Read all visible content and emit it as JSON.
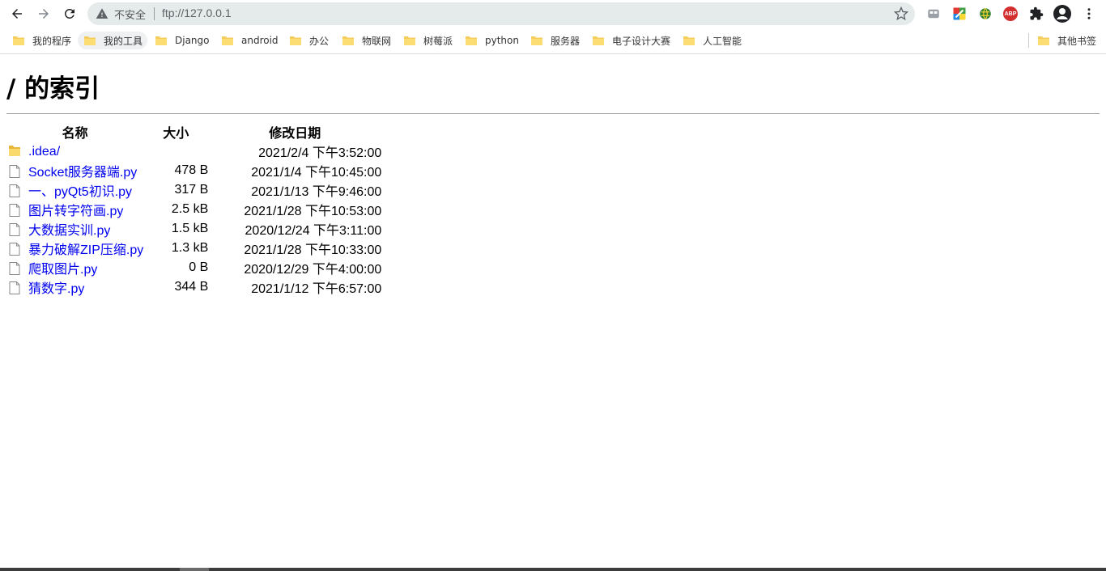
{
  "browser": {
    "security_label": "不安全",
    "url": "ftp://127.0.0.1",
    "icons": [
      "back-icon",
      "forward-icon",
      "reload-icon",
      "warning-icon",
      "star-icon",
      "tab-icon",
      "color-picker-icon",
      "globe-icon",
      "adblock-icon",
      "puzzle-icon",
      "profile-icon",
      "menu-icon"
    ],
    "adblock_label": "ABP"
  },
  "bookmarks": [
    {
      "label": "我的程序"
    },
    {
      "label": "我的工具"
    },
    {
      "label": "Django"
    },
    {
      "label": "android"
    },
    {
      "label": "办公"
    },
    {
      "label": "物联网"
    },
    {
      "label": "树莓派"
    },
    {
      "label": "python"
    },
    {
      "label": "服务器"
    },
    {
      "label": "电子设计大赛"
    },
    {
      "label": "人工智能"
    }
  ],
  "other_bookmarks": "其他书签",
  "page": {
    "title": "/ 的索引",
    "columns": {
      "name": "名称",
      "size": "大小",
      "date": "修改日期"
    },
    "files": [
      {
        "name": ".idea/",
        "size": "",
        "date": "2021/2/4 下午3:52:00",
        "type": "folder"
      },
      {
        "name": "Socket服务器端.py",
        "size": "478 B",
        "date": "2021/1/4 下午10:45:00",
        "type": "file"
      },
      {
        "name": "一、pyQt5初识.py",
        "size": "317 B",
        "date": "2021/1/13 下午9:46:00",
        "type": "file"
      },
      {
        "name": "图片转字符画.py",
        "size": "2.5 kB",
        "date": "2021/1/28 下午10:53:00",
        "type": "file"
      },
      {
        "name": "大数据实训.py",
        "size": "1.5 kB",
        "date": "2020/12/24 下午3:11:00",
        "type": "file"
      },
      {
        "name": "暴力破解ZIP压缩.py",
        "size": "1.3 kB",
        "date": "2021/1/28 下午10:33:00",
        "type": "file"
      },
      {
        "name": "爬取图片.py",
        "size": "0 B",
        "date": "2020/12/29 下午4:00:00",
        "type": "file"
      },
      {
        "name": "猜数字.py",
        "size": "344 B",
        "date": "2021/1/12 下午6:57:00",
        "type": "file"
      }
    ]
  },
  "colors": {
    "link": "#0000ee",
    "omnibox": "#e5eaea",
    "folder": "#f5cd5c"
  }
}
